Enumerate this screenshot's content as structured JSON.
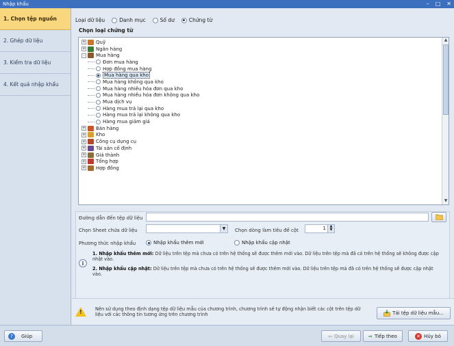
{
  "window": {
    "title": "Nhập khẩu"
  },
  "sidebar": {
    "steps": [
      {
        "label": "1. Chọn tệp nguồn",
        "active": true
      },
      {
        "label": "2. Ghép dữ liệu"
      },
      {
        "label": "3. Kiểm tra dữ liệu"
      },
      {
        "label": "4. Kết quả nhập khẩu"
      }
    ]
  },
  "data_type": {
    "label": "Loại dữ liệu",
    "options": [
      "Danh mục",
      "Số dư",
      "Chứng từ"
    ],
    "selected": "Chứng từ"
  },
  "group_title": "Chọn loại chứng từ",
  "tree": [
    {
      "label": "Quỹ",
      "kind": "folder",
      "expand": "+"
    },
    {
      "label": "Ngân hàng",
      "kind": "folder",
      "expand": "+"
    },
    {
      "label": "Mua hàng",
      "kind": "folder",
      "expand": "-"
    },
    {
      "label": "Đơn mua hàng",
      "kind": "leaf"
    },
    {
      "label": "Hợp đồng mua hàng",
      "kind": "leaf"
    },
    {
      "label": "Mua hàng qua kho",
      "kind": "leaf",
      "selected": true
    },
    {
      "label": "Mua hàng không qua kho",
      "kind": "leaf"
    },
    {
      "label": "Mua hàng nhiều hóa đơn qua kho",
      "kind": "leaf"
    },
    {
      "label": "Mua hàng nhiều hóa đơn không qua kho",
      "kind": "leaf"
    },
    {
      "label": "Mua dịch vụ",
      "kind": "leaf"
    },
    {
      "label": "Hàng mua trả lại qua kho",
      "kind": "leaf"
    },
    {
      "label": "Hàng mua trả lại không qua kho",
      "kind": "leaf"
    },
    {
      "label": "Hàng mua giảm giá",
      "kind": "leaf"
    },
    {
      "label": "Bán hàng",
      "kind": "folder",
      "expand": "+"
    },
    {
      "label": "Kho",
      "kind": "folder",
      "expand": "+"
    },
    {
      "label": "Công cụ dụng cụ",
      "kind": "folder",
      "expand": "+"
    },
    {
      "label": "Tài sản cố định",
      "kind": "folder",
      "expand": "+"
    },
    {
      "label": "Giá thành",
      "kind": "folder",
      "expand": "+"
    },
    {
      "label": "Tổng hợp",
      "kind": "folder",
      "expand": "+"
    },
    {
      "label": "Hợp đồng",
      "kind": "folder",
      "expand": "+"
    }
  ],
  "form": {
    "path_label": "Đường dẫn đến tệp dữ liệu",
    "path_value": "",
    "sheet_label": "Chọn Sheet chứa dữ liệu",
    "sheet_value": "",
    "header_row_label": "Chọn dòng làm tiêu đề cột",
    "header_row_value": "1",
    "method_label": "Phương thức nhập khẩu",
    "method_options": [
      "Nhập khẩu thêm mới",
      "Nhập khẩu cập nhật"
    ],
    "method_selected": "Nhập khẩu thêm mới"
  },
  "notes": [
    {
      "title": "1. Nhập khẩu thêm mới:",
      "text": "Dữ liệu trên tệp mà chưa có trên hệ thống sẽ được thêm mới vào. Dữ liệu trên tệp mà đã có trên hệ thống sẽ không được cập nhật vào."
    },
    {
      "title": "2. Nhập khẩu cập nhật:",
      "text": "Dữ liệu trên tệp mà chưa có trên hệ thống sẽ được thêm mới vào. Dữ liệu trên tệp mà đã có trên hệ thống sẽ được cập nhật vào."
    }
  ],
  "hint": {
    "text": "Nên sử dụng theo định dạng tệp dữ liệu mẫu của chương trình, chương trình sẽ tự động nhận biết các cột trên tệp dữ liệu với các thông tin tương ứng trên chương trình",
    "download_label": "Tải tệp dữ liệu mẫu..."
  },
  "footer": {
    "help_label": "Giúp",
    "back_label": "Quay lại",
    "next_label": "Tiếp theo",
    "cancel_label": "Hủy bỏ"
  }
}
